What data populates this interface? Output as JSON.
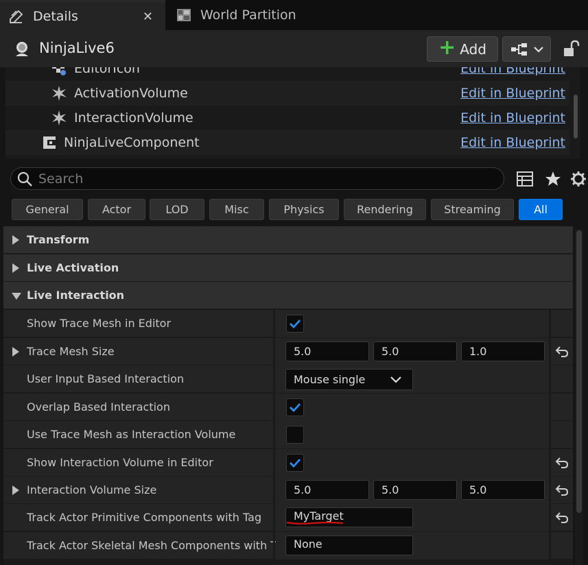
{
  "tabs": [
    {
      "label": "Details",
      "icon": "pencil-icon",
      "closable": true
    },
    {
      "label": "World Partition",
      "icon": "grid-icon"
    }
  ],
  "header": {
    "actor_name": "NinjaLive6",
    "add_label": "Add",
    "add_icon": "plus-icon",
    "blueprint_icon": "blueprint-hierarchy-icon",
    "lock_icon": "unlock-icon"
  },
  "components": [
    {
      "name": "EditorIcon",
      "link": "Edit in Blueprint"
    },
    {
      "name": "ActivationVolume",
      "link": "Edit in Blueprint"
    },
    {
      "name": "InteractionVolume",
      "link": "Edit in Blueprint"
    },
    {
      "name": "NinjaLiveComponent",
      "link": "Edit in Blueprint"
    }
  ],
  "search": {
    "placeholder": "Search"
  },
  "filters": [
    "General",
    "Actor",
    "LOD",
    "Misc",
    "Physics",
    "Rendering",
    "Streaming",
    "All"
  ],
  "active_filter": "All",
  "categories": {
    "transform": "Transform",
    "live_activation": "Live Activation",
    "live_interaction": "Live Interaction"
  },
  "properties": {
    "show_trace_mesh": {
      "label": "Show Trace Mesh in Editor",
      "checked": true
    },
    "trace_mesh_size": {
      "label": "Trace Mesh Size",
      "x": "5.0",
      "y": "5.0",
      "z": "1.0"
    },
    "user_input": {
      "label": "User Input Based Interaction",
      "value": "Mouse single"
    },
    "overlap": {
      "label": "Overlap Based Interaction",
      "checked": true
    },
    "use_trace_mesh": {
      "label": "Use Trace Mesh as Interaction Volume",
      "checked": false
    },
    "show_interaction_volume": {
      "label": "Show Interaction Volume in Editor",
      "checked": true
    },
    "interaction_volume_size": {
      "label": "Interaction Volume Size",
      "x": "5.0",
      "y": "5.0",
      "z": "5.0"
    },
    "track_primitive": {
      "label": "Track Actor Primitive Components with Tag",
      "value": "MyTarget"
    },
    "track_skeletal": {
      "label": "Track Actor Skeletal Mesh Components with Tag",
      "value": "None"
    }
  },
  "colors": {
    "accent": "#0070e0",
    "link": "#8cb4f0",
    "add_plus": "#4ec14e",
    "annotation": "#d01010"
  }
}
